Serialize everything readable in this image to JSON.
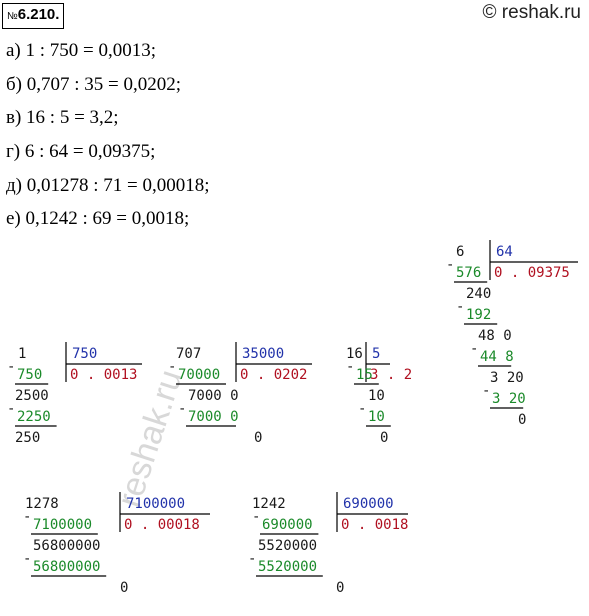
{
  "header": {
    "number_prefix": "№",
    "number": "6.210.",
    "site": "© reshak.ru"
  },
  "problems": [
    "а) 1 : 750 = 0,0013;",
    "б) 0,707 : 35 = 0,0202;",
    "в) 16 : 5 = 3,2;",
    "г) 6 : 64 = 0,09375;",
    "д) 0,01278 : 71 = 0,00018;",
    "е) 0,1242 : 69 = 0,0018;"
  ],
  "watermark": "reshak.ru",
  "divisions": {
    "a": {
      "dividend": "1",
      "divisor": "750",
      "quotient": "0 . 0013",
      "rows": [
        {
          "t": "750",
          "c": "grn",
          "m": true
        },
        {
          "t": "2500",
          "c": "blk"
        },
        {
          "t": "2250",
          "c": "grn",
          "m": true
        },
        {
          "t": "250",
          "c": "blk"
        }
      ]
    },
    "b": {
      "dividend": "707",
      "divisor": "35000",
      "quotient": "0 . 0202",
      "rows": [
        {
          "t": "70000",
          "c": "grn",
          "m": true
        },
        {
          "t": "7000 0",
          "c": "blk"
        },
        {
          "t": "7000 0",
          "c": "grn",
          "m": true
        },
        {
          "t": "0",
          "c": "blk"
        }
      ]
    },
    "c": {
      "dividend": "16",
      "divisor": "5",
      "quotient": "3 . 2",
      "rows": [
        {
          "t": "15",
          "c": "grn",
          "m": true
        },
        {
          "t": "10",
          "c": "blk"
        },
        {
          "t": "10",
          "c": "grn",
          "m": true
        },
        {
          "t": "0",
          "c": "blk"
        }
      ]
    },
    "d": {
      "dividend": "6",
      "divisor": "64",
      "quotient": "0 . 09375",
      "rows": [
        {
          "t": "576",
          "c": "grn",
          "m": true
        },
        {
          "t": "240",
          "c": "blk"
        },
        {
          "t": "192",
          "c": "grn",
          "m": true
        },
        {
          "t": "48 0",
          "c": "blk"
        },
        {
          "t": "44 8",
          "c": "grn",
          "m": true
        },
        {
          "t": "3 20",
          "c": "blk"
        },
        {
          "t": "3 20",
          "c": "grn",
          "m": true
        },
        {
          "t": "0",
          "c": "blk"
        }
      ]
    },
    "e": {
      "dividend": "1278",
      "divisor": "7100000",
      "quotient": "0 . 00018",
      "rows": [
        {
          "t": "7100000",
          "c": "grn",
          "m": true
        },
        {
          "t": "56800000",
          "c": "blk"
        },
        {
          "t": "56800000",
          "c": "grn",
          "m": true
        },
        {
          "t": "0",
          "c": "blk"
        }
      ]
    },
    "f": {
      "dividend": "1242",
      "divisor": "690000",
      "quotient": "0 . 0018",
      "rows": [
        {
          "t": "690000",
          "c": "grn",
          "m": true
        },
        {
          "t": "5520000",
          "c": "blk"
        },
        {
          "t": "5520000",
          "c": "grn",
          "m": true
        },
        {
          "t": "0",
          "c": "blk"
        }
      ]
    }
  }
}
